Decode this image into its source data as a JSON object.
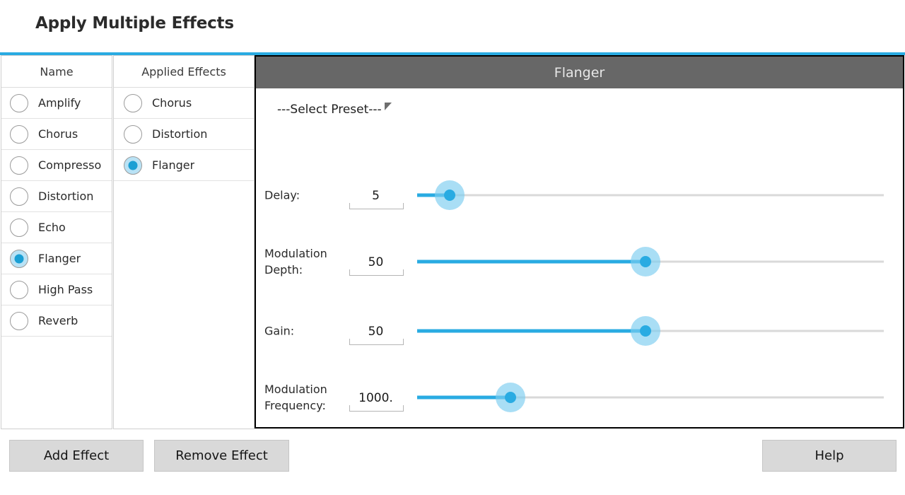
{
  "page_title": "Apply Multiple Effects",
  "accent_color": "#29ABE2",
  "names_list": {
    "header": "Name",
    "items": [
      {
        "label": "Amplify",
        "selected": false
      },
      {
        "label": "Chorus",
        "selected": false
      },
      {
        "label": "Compresso",
        "selected": false
      },
      {
        "label": "Distortion",
        "selected": false
      },
      {
        "label": "Echo",
        "selected": false
      },
      {
        "label": "Flanger",
        "selected": true
      },
      {
        "label": "High Pass",
        "selected": false
      },
      {
        "label": "Reverb",
        "selected": false
      }
    ]
  },
  "applied_list": {
    "header": "Applied Effects",
    "items": [
      {
        "label": "Chorus",
        "selected": false
      },
      {
        "label": "Distortion",
        "selected": false
      },
      {
        "label": "Flanger",
        "selected": true
      }
    ]
  },
  "editor": {
    "title": "Flanger",
    "preset": {
      "label": "---Select Preset---"
    },
    "params": [
      {
        "label": "Delay:",
        "value": "5",
        "fill_percent": 7
      },
      {
        "label": "Modulation Depth:",
        "value": "50",
        "fill_percent": 49
      },
      {
        "label": "Gain:",
        "value": "50",
        "fill_percent": 49
      },
      {
        "label": "Modulation Frequency:",
        "value": "1000.",
        "fill_percent": 20
      }
    ]
  },
  "buttons": {
    "add_effect": "Add Effect",
    "remove_effect": "Remove Effect",
    "help": "Help"
  }
}
